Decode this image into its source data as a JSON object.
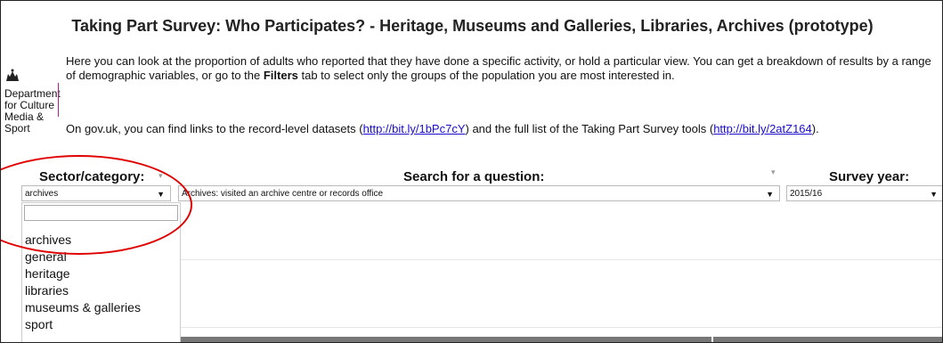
{
  "header": {
    "title": "Taking Part Survey: Who Participates? - Heritage, Museums and Galleries, Libraries, Archives (prototype)"
  },
  "logo": {
    "crest_icon": "royal-crest-icon",
    "line1": "Department",
    "line2": "for Culture",
    "line3": "Media & Sport",
    "accent_color": "#b0228c"
  },
  "intro": {
    "para1_part1": "Here you can look at the proportion of adults who reported that they have done a specific activity, or hold a particular view. You can get a breakdown of results by a range of demographic variables, or go to the ",
    "para1_bold": "Filters",
    "para1_part2": " tab to select only the groups of the population you are most interested in.",
    "para2_part1": "On gov.uk, you can find links to the record-level datasets (",
    "link1": "http://bit.ly/1bPc7cY",
    "para2_part2": ") and the full list of the Taking Part Survey tools (",
    "link2": "http://bit.ly/2atZ164",
    "para2_part3": ")."
  },
  "filters": {
    "sector_label": "Sector/category:",
    "sector_value": "archives",
    "question_label": "Search for a question:",
    "question_value": "Archives: visited an archive centre or records office",
    "year_label": "Survey year:",
    "year_value": "2015/16",
    "sort_icon": "▾",
    "dropdown_arrow": "▼"
  },
  "dropdown": {
    "options": [
      "archives",
      "general",
      "heritage",
      "libraries",
      "museums & galleries",
      "sport"
    ]
  },
  "annotation": {
    "circle_color": "#e00000"
  }
}
